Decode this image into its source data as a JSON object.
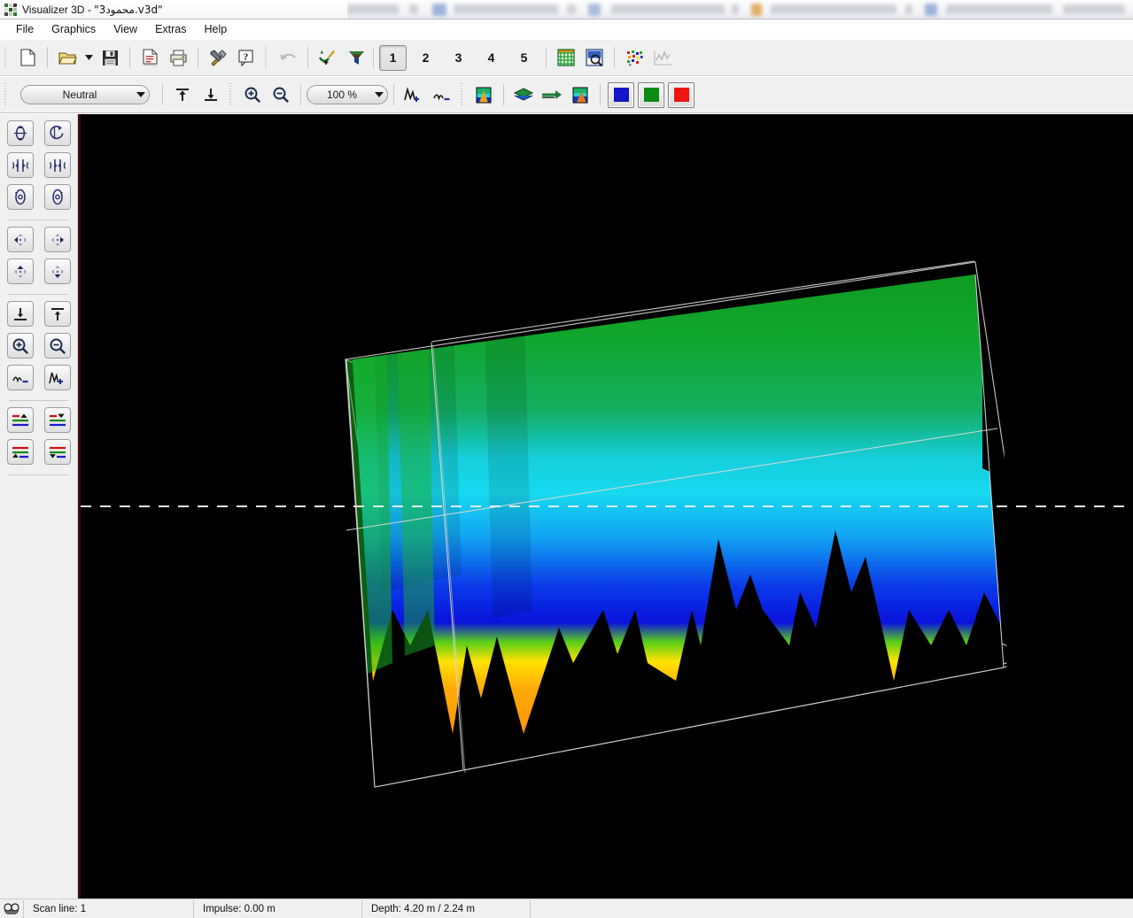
{
  "window": {
    "title_app": "Visualizer 3D",
    "title_sep": " - ",
    "title_file": "\"3محمود.v3d\"",
    "icon": "visualizer-3d-icon"
  },
  "menubar": {
    "items": [
      {
        "label": "File",
        "name": "menu-file"
      },
      {
        "label": "Graphics",
        "name": "menu-graphics"
      },
      {
        "label": "View",
        "name": "menu-view"
      },
      {
        "label": "Extras",
        "name": "menu-extras"
      },
      {
        "label": "Help",
        "name": "menu-help"
      }
    ]
  },
  "toolbar_main": {
    "buttons": [
      {
        "name": "new-file-button",
        "icon": "new-document-icon",
        "tooltip": "New"
      },
      {
        "name": "open-file-button",
        "icon": "open-folder-icon",
        "tooltip": "Open"
      },
      {
        "name": "open-recent-dropdown",
        "icon": "chevron-down-icon",
        "tooltip": "Recent files"
      },
      {
        "name": "save-file-button",
        "icon": "floppy-disk-icon",
        "tooltip": "Save"
      },
      {
        "name": "report-button",
        "icon": "document-lines-icon",
        "tooltip": "Report"
      },
      {
        "name": "print-button",
        "icon": "printer-icon",
        "tooltip": "Print"
      },
      {
        "name": "settings-button",
        "icon": "hammer-wrench-icon",
        "tooltip": "Settings"
      },
      {
        "name": "help-button",
        "icon": "question-mark-icon",
        "tooltip": "Help"
      },
      {
        "name": "undo-button",
        "icon": "undo-arrow-icon",
        "tooltip": "Undo",
        "disabled": true
      },
      {
        "name": "filter-signal-button",
        "icon": "signal-wand-icon",
        "tooltip": "Signal filter"
      },
      {
        "name": "filter-funnel-button",
        "icon": "funnel-icon",
        "tooltip": "Filter"
      },
      {
        "name": "grid-view-button",
        "icon": "grid-icon",
        "tooltip": "Grid"
      },
      {
        "name": "inspect-view-button",
        "icon": "magnifier-window-icon",
        "tooltip": "Inspect"
      },
      {
        "name": "points-view-button",
        "icon": "scatter-points-icon",
        "tooltip": "Point cloud"
      },
      {
        "name": "graph-view-button",
        "icon": "line-graph-icon",
        "tooltip": "Graph",
        "disabled": true
      }
    ],
    "view_numbers": [
      "1",
      "2",
      "3",
      "4",
      "5"
    ],
    "view_selected": "1"
  },
  "toolbar_second": {
    "palette_value": "Neutral",
    "zoom_value": "100 %",
    "buttons": [
      {
        "name": "top-align-button",
        "icon": "align-top-icon"
      },
      {
        "name": "bottom-align-button",
        "icon": "align-bottom-icon"
      },
      {
        "name": "zoom-in-button",
        "icon": "magnifier-plus-icon"
      },
      {
        "name": "zoom-out-button",
        "icon": "magnifier-minus-icon"
      },
      {
        "name": "signal-increase-button",
        "icon": "signal-plus-icon"
      },
      {
        "name": "signal-decrease-button",
        "icon": "signal-minus-icon"
      },
      {
        "name": "surface-map-button",
        "icon": "color-map-icon"
      },
      {
        "name": "layer-button",
        "icon": "layers-icon"
      },
      {
        "name": "slice-button",
        "icon": "slice-arrow-icon"
      },
      {
        "name": "texture-map-button",
        "icon": "color-map-2-icon"
      }
    ],
    "color_swatches": [
      {
        "name": "color-swatch-blue",
        "color": "#1414c8"
      },
      {
        "name": "color-swatch-green",
        "color": "#0a8c12"
      },
      {
        "name": "color-swatch-red",
        "color": "#ef1414"
      }
    ]
  },
  "sidebar": {
    "groups": [
      {
        "name": "rotation-group",
        "buttons": [
          {
            "name": "rotate-x-up-button",
            "icon": "rotate-x-up-icon"
          },
          {
            "name": "rotate-x-down-button",
            "icon": "rotate-x-down-icon"
          },
          {
            "name": "rotate-y-left-button",
            "icon": "rotate-y-left-icon"
          },
          {
            "name": "rotate-y-right-button",
            "icon": "rotate-y-right-icon"
          },
          {
            "name": "rotate-z-left-button",
            "icon": "rotate-z-left-icon"
          },
          {
            "name": "rotate-z-right-button",
            "icon": "rotate-z-right-icon"
          }
        ]
      },
      {
        "name": "pan-group",
        "buttons": [
          {
            "name": "pan-left-button",
            "icon": "move-left-icon"
          },
          {
            "name": "pan-right-button",
            "icon": "move-right-icon"
          },
          {
            "name": "pan-up-button",
            "icon": "move-up-icon"
          },
          {
            "name": "pan-down-button",
            "icon": "move-down-icon"
          }
        ]
      },
      {
        "name": "scale-group",
        "buttons": [
          {
            "name": "lower-plane-button",
            "icon": "arrow-down-to-line-icon"
          },
          {
            "name": "raise-plane-button",
            "icon": "arrow-up-to-line-icon"
          },
          {
            "name": "view-zoom-in-button",
            "icon": "magnifier-plus-icon"
          },
          {
            "name": "view-zoom-out-button",
            "icon": "magnifier-minus-icon"
          },
          {
            "name": "amplitude-down-button",
            "icon": "signal-minus-icon"
          },
          {
            "name": "amplitude-up-button",
            "icon": "signal-plus-icon"
          }
        ]
      },
      {
        "name": "color-range-group",
        "buttons": [
          {
            "name": "color-upper-raise-button",
            "icon": "colorbar-up-top-icon"
          },
          {
            "name": "color-upper-lower-button",
            "icon": "colorbar-down-top-icon"
          },
          {
            "name": "color-lower-raise-button",
            "icon": "colorbar-up-bottom-icon"
          },
          {
            "name": "color-lower-lower-button",
            "icon": "colorbar-down-bottom-icon"
          }
        ]
      }
    ]
  },
  "statusbar": {
    "icon": "scan-pattern-icon",
    "scan_line": "Scan line: 1",
    "impulse": "Impulse: 0.00 m",
    "depth": "Depth: 4.20 m / 2.24 m"
  },
  "viewport": {
    "background": "#000000",
    "frame_color": "#d9d9d9",
    "crosshair_color": "#f2f2f2",
    "colors": {
      "green": "#16a81c",
      "cyan": "#15d8ef",
      "blue": "#0a1ee6",
      "yellow": "#ffe000",
      "orange": "#ff9505"
    }
  }
}
